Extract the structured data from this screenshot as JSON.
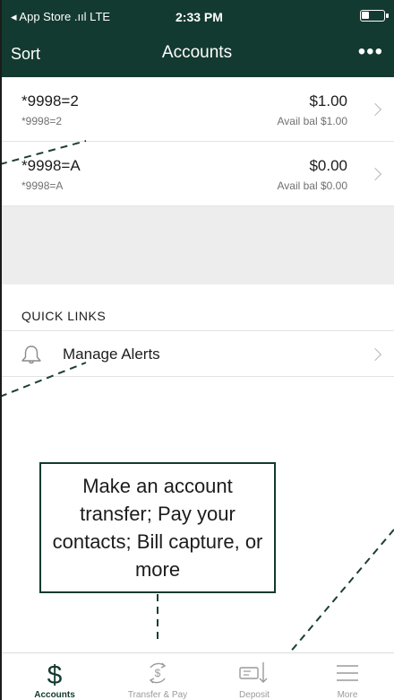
{
  "status_bar": {
    "carrier": "◂ App Store .ııl LTE",
    "time": "2:33 PM",
    "battery_level": 0.35
  },
  "nav": {
    "left_label": "Sort",
    "title": "Accounts",
    "menu_label": "•••"
  },
  "accounts": [
    {
      "name": "*9998=2",
      "sub": "*9998=2",
      "amount": "$1.00",
      "avail": "Avail bal $1.00"
    },
    {
      "name": "*9998=A",
      "sub": "*9998=A",
      "amount": "$0.00",
      "avail": "Avail bal $0.00"
    }
  ],
  "quick_links": {
    "header": "QUICK LINKS",
    "items": [
      {
        "label": "Manage Alerts",
        "icon": "bell-icon"
      }
    ]
  },
  "callout": {
    "text": "Make an account transfer; Pay your contacts; Bill capture, or more"
  },
  "tabs": [
    {
      "label": "Accounts",
      "icon": "dollar-icon",
      "active": true
    },
    {
      "label": "Transfer & Pay",
      "icon": "transfer-pay-icon",
      "active": false
    },
    {
      "label": "Deposit",
      "icon": "deposit-check-icon",
      "active": false
    },
    {
      "label": "More",
      "icon": "hamburger-menu-icon",
      "active": false
    }
  ],
  "colors": {
    "brand": "#133a30",
    "annotation_line": "#1c3f35",
    "inactive_tab": "#9a9a9a"
  }
}
